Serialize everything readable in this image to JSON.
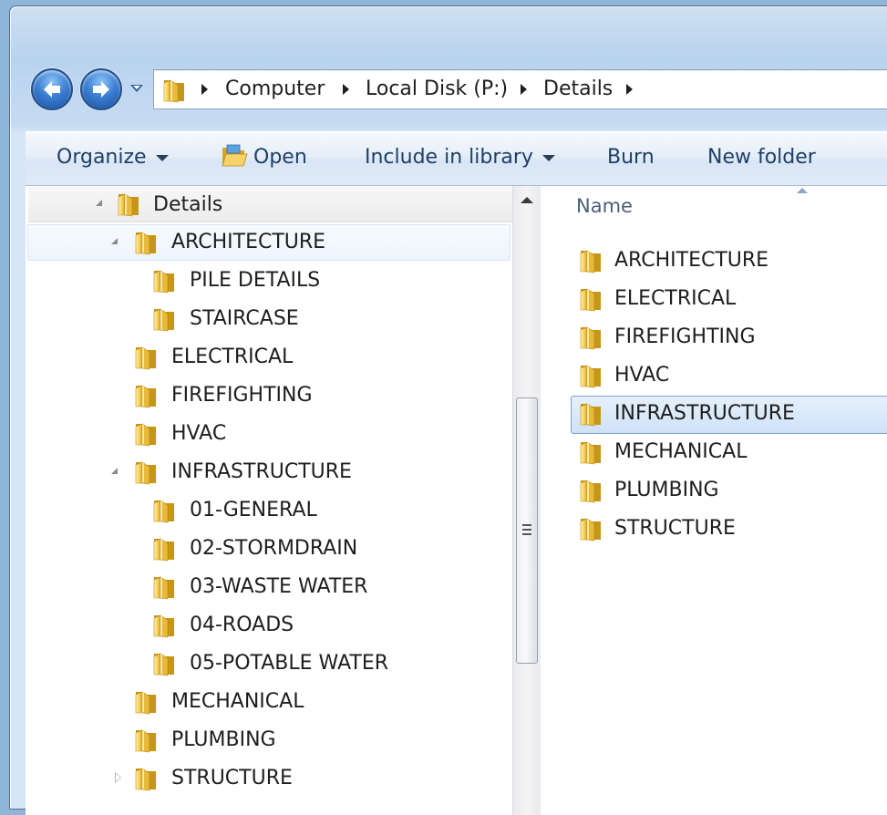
{
  "address_bar": {
    "crumbs": [
      "Computer",
      "Local Disk (P:)",
      "Details"
    ]
  },
  "toolbar": {
    "organize": "Organize",
    "open": "Open",
    "include_in_library": "Include in library",
    "burn": "Burn",
    "new_folder": "New folder"
  },
  "nav_tree": {
    "root": "Details",
    "items": [
      {
        "label": "ARCHITECTURE",
        "level": 1,
        "expanded": true
      },
      {
        "label": "PILE DETAILS",
        "level": 2
      },
      {
        "label": "STAIRCASE",
        "level": 2
      },
      {
        "label": "ELECTRICAL",
        "level": 1
      },
      {
        "label": "FIREFIGHTING",
        "level": 1
      },
      {
        "label": "HVAC",
        "level": 1
      },
      {
        "label": "INFRASTRUCTURE",
        "level": 1,
        "expanded": true
      },
      {
        "label": "01-GENERAL",
        "level": 2
      },
      {
        "label": "02-STORMDRAIN",
        "level": 2
      },
      {
        "label": "03-WASTE WATER",
        "level": 2
      },
      {
        "label": "04-ROADS",
        "level": 2
      },
      {
        "label": "05-POTABLE WATER",
        "level": 2
      },
      {
        "label": "MECHANICAL",
        "level": 1
      },
      {
        "label": "PLUMBING",
        "level": 1
      },
      {
        "label": "STRUCTURE",
        "level": 1,
        "expanded": false
      }
    ]
  },
  "content": {
    "column_name": "Name",
    "items": [
      "ARCHITECTURE",
      "ELECTRICAL",
      "FIREFIGHTING",
      "HVAC",
      "INFRASTRUCTURE",
      "MECHANICAL",
      "PLUMBING",
      "STRUCTURE"
    ],
    "selected": "INFRASTRUCTURE"
  },
  "colors": {
    "folder": "#f3c94e",
    "selection": "#cfe2f8",
    "toolbar_text": "#1e3f66"
  }
}
